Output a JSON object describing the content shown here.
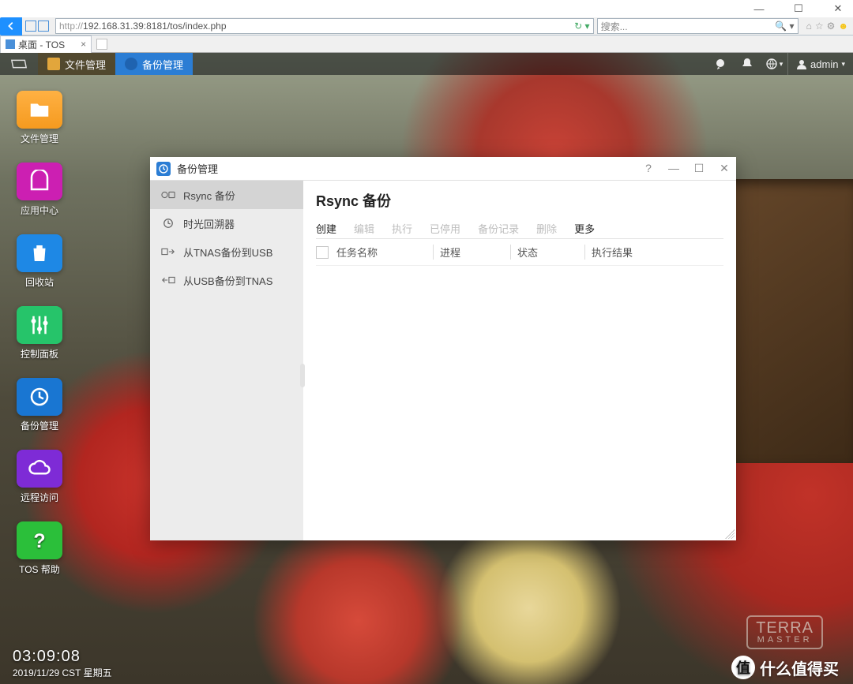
{
  "browser": {
    "url_scheme": "http://",
    "url_rest": "192.168.31.39:8181/tos/index.php",
    "search_placeholder": "搜索...",
    "tab_title": "桌面 - TOS"
  },
  "taskbar": {
    "file_label": "文件管理",
    "backup_label": "备份管理",
    "user": "admin"
  },
  "desktop_icons": {
    "file": "文件管理",
    "appcenter": "应用中心",
    "recycle": "回收站",
    "control": "控制面板",
    "backup": "备份管理",
    "remote": "远程访问",
    "help": "TOS 帮助"
  },
  "clock": {
    "time": "03:09:08",
    "date": "2019/11/29 CST 星期五"
  },
  "brand": {
    "line1": "TERRA",
    "line2": "MASTER"
  },
  "watermark": "什么值得买",
  "app": {
    "title": "备份管理",
    "sidebar": {
      "rsync": "Rsync 备份",
      "timemachine": "时光回溯器",
      "tnas2usb": "从TNAS备份到USB",
      "usb2tnas": "从USB备份到TNAS"
    },
    "heading": "Rsync 备份",
    "tabs": {
      "create": "创建",
      "edit": "编辑",
      "run": "执行",
      "disabled": "已停用",
      "log": "备份记录",
      "delete": "删除",
      "more": "更多"
    },
    "columns": {
      "name": "任务名称",
      "proc": "进程",
      "status": "状态",
      "result": "执行结果"
    }
  }
}
